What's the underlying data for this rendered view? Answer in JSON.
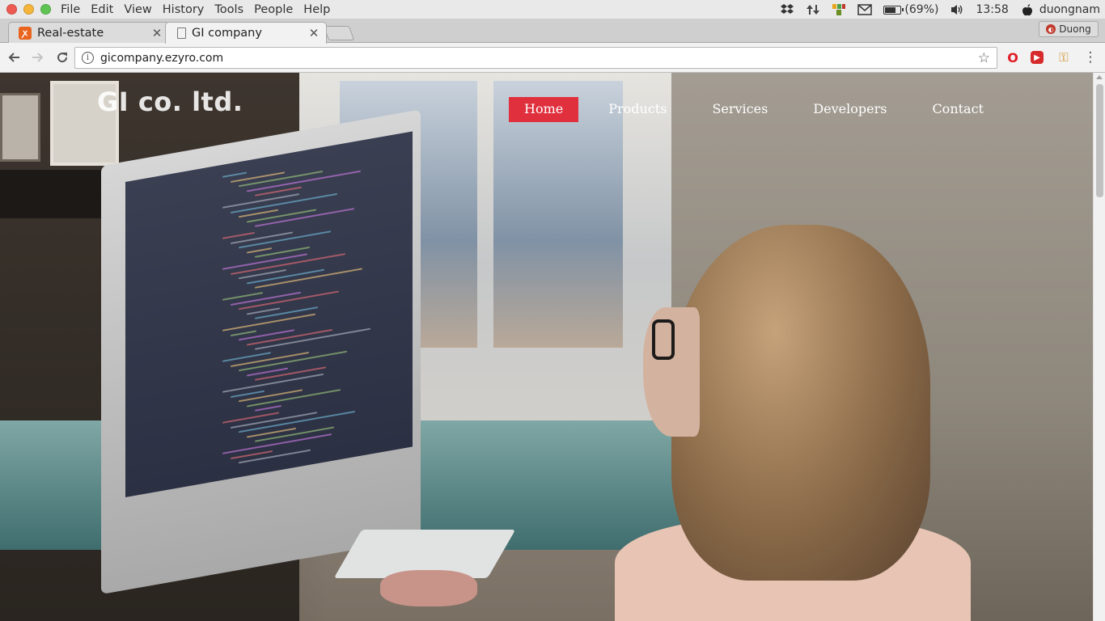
{
  "os_menubar": {
    "menus": [
      "File",
      "Edit",
      "View",
      "History",
      "Tools",
      "People",
      "Help"
    ],
    "battery_percent": "(69%)",
    "battery_level": 0.69,
    "time": "13:58",
    "user": "duongnam",
    "icons": [
      "dropbox-icon",
      "network-transfer-icon",
      "vscode-like-icon",
      "mail-icon",
      "battery-icon",
      "volume-icon",
      "apple-icon"
    ]
  },
  "tabs": [
    {
      "title": "Real-estate",
      "favicon": "orange-x-icon",
      "active": false
    },
    {
      "title": "GI company",
      "favicon": "document-icon",
      "active": true
    }
  ],
  "profile": {
    "label": "Duong"
  },
  "toolbar": {
    "url": "gicompany.ezyro.com"
  },
  "site": {
    "logo": "GI co. ltd.",
    "nav": [
      {
        "label": "Home",
        "active": true
      },
      {
        "label": "Products",
        "active": false
      },
      {
        "label": "Services",
        "active": false
      },
      {
        "label": "Developers",
        "active": false
      },
      {
        "label": "Contact",
        "active": false
      }
    ],
    "accent_color": "#e0303e"
  }
}
